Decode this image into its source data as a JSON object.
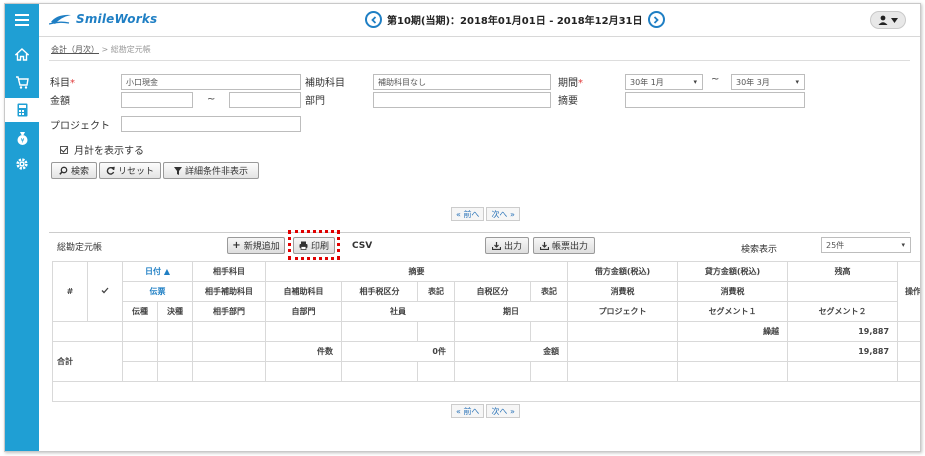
{
  "app": {
    "logo_text": "SmileWorks",
    "period_title": "第10期(当期)：2018年01月01日 - 2018年12月31日"
  },
  "sidebar": {
    "items": [
      {
        "name": "menu-icon"
      },
      {
        "name": "home-icon"
      },
      {
        "name": "cart-icon"
      },
      {
        "name": "calculator-icon"
      },
      {
        "name": "money-bag-icon"
      },
      {
        "name": "gear-icon"
      }
    ]
  },
  "breadcrumb": {
    "parent": "会計（月次）",
    "sep": ">",
    "current": "総勘定元帳"
  },
  "form": {
    "account_label": "科目",
    "account_value": "小口現金",
    "sub_account_label": "補助科目",
    "sub_account_value": "補助科目なし",
    "period_label": "期間",
    "period_from": "30年 1月",
    "period_tilde": "~",
    "period_to": "30年 3月",
    "amount_label": "金額",
    "amount_from": "",
    "amount_tilde": "~",
    "amount_to": "",
    "dept_label": "部門",
    "dept_value": "",
    "memo_label": "摘要",
    "memo_value": "",
    "project_label": "プロジェクト",
    "project_value": "",
    "monthly_total_label": "月計を表示する",
    "required_mark": "*"
  },
  "buttons": {
    "search": "検索",
    "reset": "リセット",
    "toggle_detail": "詳細条件非表示",
    "prev": "« 前へ",
    "next": "次へ »",
    "new": "新規追加",
    "print": "印刷",
    "csv": "CSV",
    "output": "出力",
    "ledger_output": "帳票出力"
  },
  "ledger": {
    "title": "総勘定元帳",
    "display_count_label": "検索表示",
    "display_count_value": "25件"
  },
  "table": {
    "h1": {
      "num": "#",
      "date": "日付 ▲",
      "counter_account": "相手科目",
      "summary": "摘要",
      "debit": "借方金額(税込)",
      "credit": "貸方金額(税込)",
      "balance": "残高",
      "ops": "操作"
    },
    "h2": {
      "slip": "伝票",
      "counter_sub": "相手補助科目",
      "own_sub": "自補助科目",
      "counter_tax": "相手税区分",
      "notation1": "表記",
      "own_tax": "自税区分",
      "notation2": "表記",
      "debit_tax": "消費税",
      "credit_tax": "消費税"
    },
    "h3": {
      "slip_type": "伝種",
      "settle": "決種",
      "counter_dept": "相手部門",
      "own_dept": "自部門",
      "partner": "社員",
      "issue": "期日",
      "project": "プロジェクト",
      "segment1": "セグメント１",
      "segment2": "セグメント２"
    },
    "summary": {
      "carryover_label": "繰越",
      "carryover_value": "19,887",
      "total_label": "合計",
      "count_label": "件数",
      "count_value": "0件",
      "amount_label": "金額",
      "total_value": "19,887"
    }
  }
}
